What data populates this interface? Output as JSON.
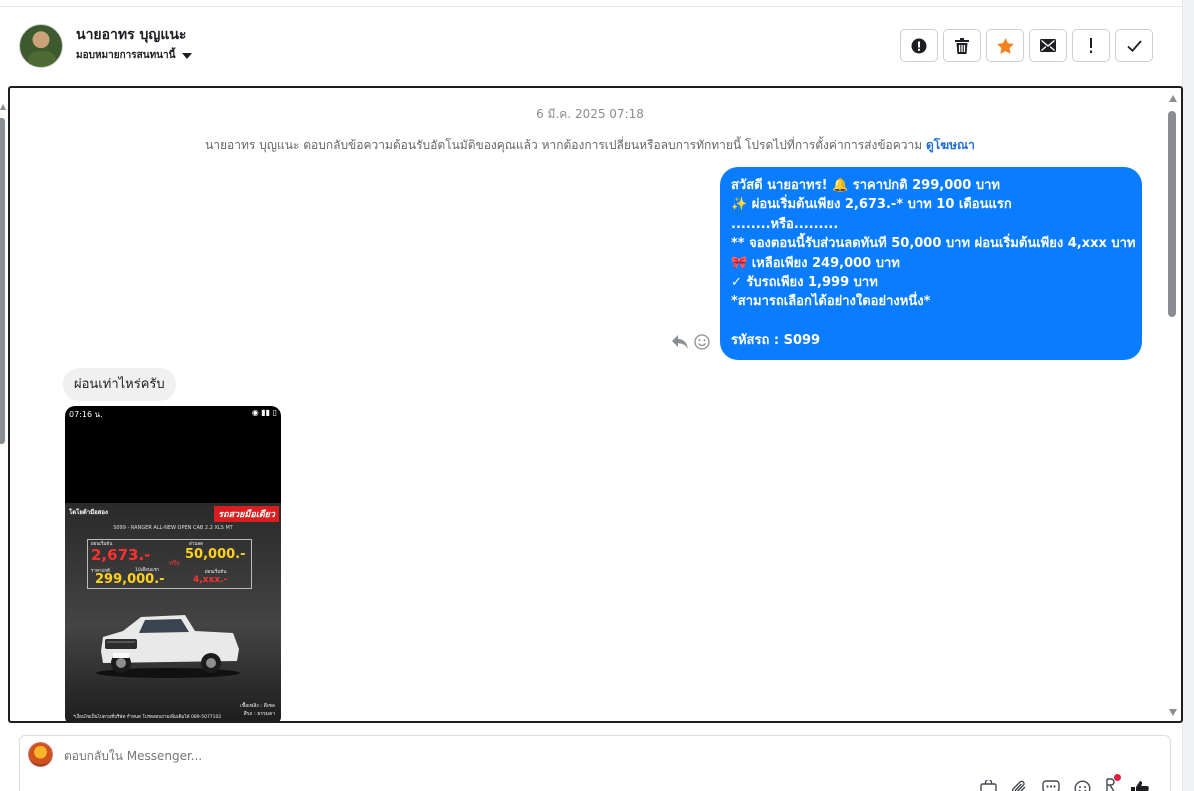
{
  "header": {
    "contact_name": "นายอาทร บุญแนะ",
    "assign_label": "มอบหมายการสนทนานี้",
    "actions": [
      {
        "name": "report-spam-button",
        "icon": "alert-circle-icon"
      },
      {
        "name": "delete-button",
        "icon": "trash-icon"
      },
      {
        "name": "star-button",
        "icon": "star-icon",
        "color": "#f5821f"
      },
      {
        "name": "mark-unread-button",
        "icon": "envelope-icon"
      },
      {
        "name": "follow-up-button",
        "icon": "exclamation-icon"
      },
      {
        "name": "mark-done-button",
        "icon": "check-icon"
      }
    ]
  },
  "conversation": {
    "timestamp": "6 มี.ค. 2025 07:18",
    "notice": "นายอาทร บุญแนะ ตอบกลับข้อความต้อนรับอัตโนมัติของคุณแล้ว หากต้องการเปลี่ยนหรือลบการทักทายนี้ โปรดไปที่การตั้งค่าการส่งข้อความ",
    "notice_link": "ดูโฆษณา",
    "outgoing_lines": [
      "สวัสดี นายอาทร! 🔔  ราคาปกติ 299,000 บาท",
      "✨  ผ่อนเริ่มต้นเพียง 2,673.-* บาท 10 เดือนแรก",
      "........หรือ.........",
      "** จองตอนนี้รับส่วนลดทันที 50,000 บาท ผ่อนเริ่มต้นเพียง 4,xxx บาท",
      "🎀  เหลือเพียง 249,000 บาท",
      "✓ รับรถเพียง 1,999 บาท",
      "*สามารถเลือกได้อย่างใดอย่างหนึ่ง*",
      "",
      " รหัสรถ : S099"
    ],
    "incoming_text": "ผ่อนเท่าไหร่ครับ",
    "outgoing_color": "#0a7cff",
    "attachment": {
      "status_time": "07:16 น.",
      "brand": "โตโยต้ามือสอง",
      "tag": "รถสวยมือเดียว",
      "model": "S099 - RANGER ALL-NEW OPEN CAB 2.2 XLS MT",
      "label_installment": "ผ่อนเริ่มต้น",
      "price_installment": "2,673.-",
      "label_installment_note": "10เดือนแรก",
      "or_text": "หรือ",
      "label_discount": "ส่วนลด",
      "price_discount": "50,000.-",
      "label_normal": "ราคาปกติ",
      "price_normal": "299,000.-",
      "label_installment2": "ผ่อนเริ่มต้น",
      "price_installment2": "4,xxx.-",
      "fuel": "เชื้อเพลิง : ดีเซล",
      "color": "สีรถ : ธรรมดา",
      "footnote": "*เงื่อนไขเป็นไปตามที่บริษัท กำหนด โปรดสอบถามเพิ่มเติมได้ 089-5077102"
    }
  },
  "composer": {
    "placeholder": "ตอบกลับใน Messenger...",
    "tools": [
      "bag-icon",
      "paperclip-icon",
      "chat-dots-icon",
      "emoji-icon",
      "quick-reply-icon",
      "thumbs-up-icon"
    ],
    "notification_color": "#e41e3f"
  }
}
